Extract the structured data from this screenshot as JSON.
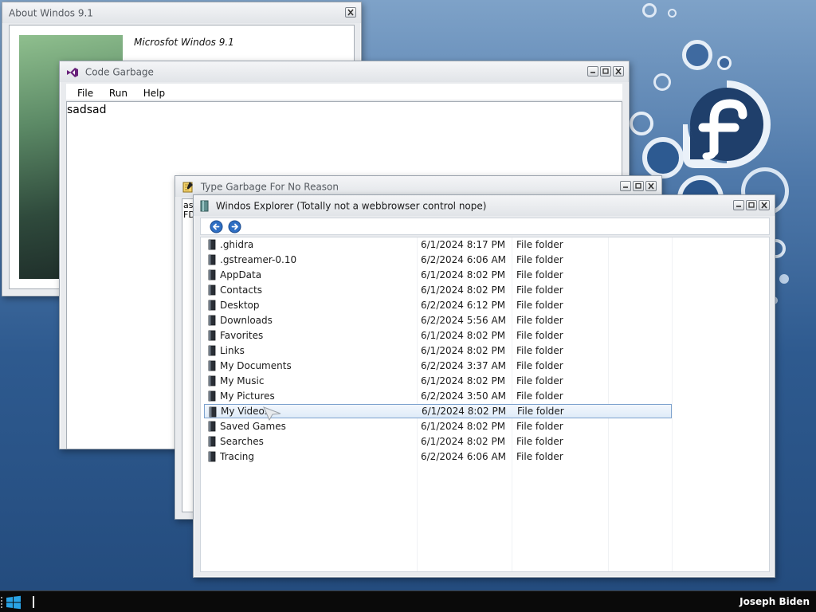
{
  "desktop": {
    "logo_icon": "fedora-logo-icon"
  },
  "about_window": {
    "title": "About Windos 9.1",
    "product_name": "Microsfot Windos 9.1"
  },
  "code_window": {
    "title": "Code Garbage",
    "icon": "visual-studio-icon",
    "menu": [
      "File",
      "Run",
      "Help"
    ],
    "editor_text": "sadsad"
  },
  "type_window": {
    "title": "Type Garbage For No Reason",
    "icon": "notepad-icon",
    "text_line1": "ast",
    "text_line2": "FD"
  },
  "explorer_window": {
    "title": "Windos Explorer (Totally not a webbrowser control nope)",
    "icon": "folder-book-icon",
    "back_icon": "back-arrow-icon",
    "forward_icon": "forward-arrow-icon",
    "selected_index": 11,
    "files": [
      {
        "name": ".ghidra",
        "date": "6/1/2024 8:17 PM",
        "type": "File folder"
      },
      {
        "name": ".gstreamer-0.10",
        "date": "6/2/2024 6:06 AM",
        "type": "File folder"
      },
      {
        "name": "AppData",
        "date": "6/1/2024 8:02 PM",
        "type": "File folder"
      },
      {
        "name": "Contacts",
        "date": "6/1/2024 8:02 PM",
        "type": "File folder"
      },
      {
        "name": "Desktop",
        "date": "6/2/2024 6:12 PM",
        "type": "File folder"
      },
      {
        "name": "Downloads",
        "date": "6/2/2024 5:56 AM",
        "type": "File folder"
      },
      {
        "name": "Favorites",
        "date": "6/1/2024 8:02 PM",
        "type": "File folder"
      },
      {
        "name": "Links",
        "date": "6/1/2024 8:02 PM",
        "type": "File folder"
      },
      {
        "name": "My Documents",
        "date": "6/2/2024 3:37 AM",
        "type": "File folder"
      },
      {
        "name": "My Music",
        "date": "6/1/2024 8:02 PM",
        "type": "File folder"
      },
      {
        "name": "My Pictures",
        "date": "6/2/2024 3:50 AM",
        "type": "File folder"
      },
      {
        "name": "My Videos",
        "date": "6/1/2024 8:02 PM",
        "type": "File folder"
      },
      {
        "name": "Saved Games",
        "date": "6/1/2024 8:02 PM",
        "type": "File folder"
      },
      {
        "name": "Searches",
        "date": "6/1/2024 8:02 PM",
        "type": "File folder"
      },
      {
        "name": "Tracing",
        "date": "6/2/2024 6:06 AM",
        "type": "File folder"
      }
    ]
  },
  "taskbar": {
    "start_icon": "windows-logo-icon",
    "user_name": "Joseph Biden"
  },
  "colors": {
    "desktop_blue": "#2e5a8f",
    "selection_border": "#7da2ce",
    "taskbar": "#0a0a0a"
  }
}
